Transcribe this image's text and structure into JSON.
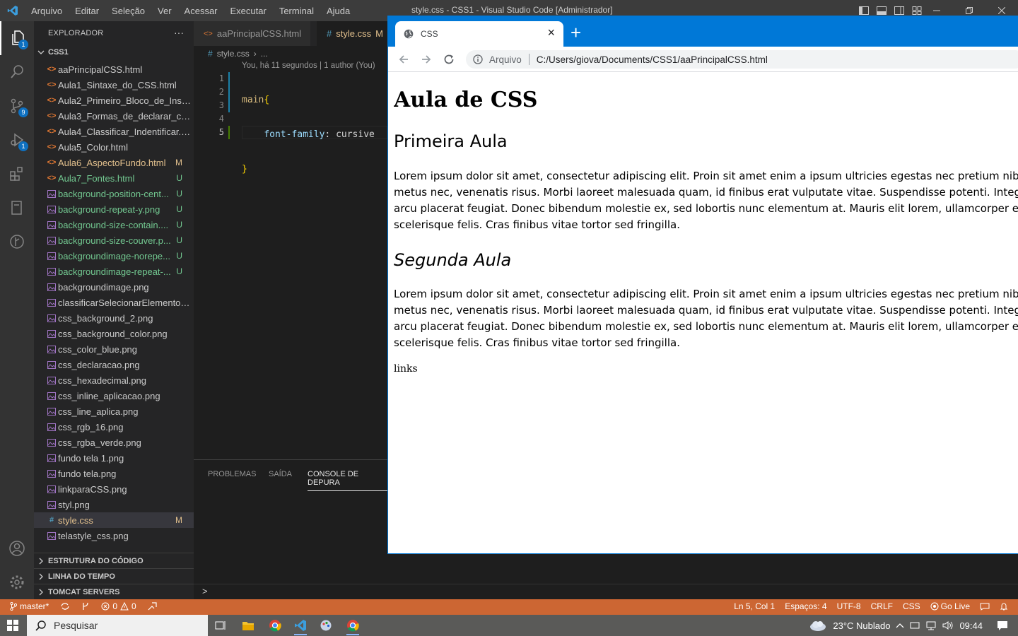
{
  "titlebar": {
    "menu": [
      "Arquivo",
      "Editar",
      "Seleção",
      "Ver",
      "Acessar",
      "Executar",
      "Terminal",
      "Ajuda"
    ],
    "title": "style.css - CSS1 - Visual Studio Code [Administrador]"
  },
  "activity": {
    "explorer_badge": "1",
    "scm_badge": "9",
    "debug_badge": "1"
  },
  "sidebar": {
    "title": "EXPLORADOR",
    "more": "···",
    "folder": "CSS1",
    "files": [
      {
        "icon": "<>",
        "name": "aaPrincipalCSS.html",
        "badge": "",
        "color": "#cccccc",
        "iconcolor": "#e37933"
      },
      {
        "icon": "<>",
        "name": "Aula1_Sintaxe_do_CSS.html",
        "badge": "",
        "color": "#cccccc",
        "iconcolor": "#e37933"
      },
      {
        "icon": "<>",
        "name": "Aula2_Primeiro_Bloco_de_Instru...",
        "badge": "",
        "color": "#cccccc",
        "iconcolor": "#e37933"
      },
      {
        "icon": "<>",
        "name": "Aula3_Formas_de_declarar_css....",
        "badge": "",
        "color": "#cccccc",
        "iconcolor": "#e37933"
      },
      {
        "icon": "<>",
        "name": "Aula4_Classificar_Indentificar.html",
        "badge": "",
        "color": "#cccccc",
        "iconcolor": "#e37933"
      },
      {
        "icon": "<>",
        "name": "Aula5_Color.html",
        "badge": "",
        "color": "#cccccc",
        "iconcolor": "#e37933"
      },
      {
        "icon": "<>",
        "name": "Aula6_AspectoFundo.html",
        "badge": "M",
        "color": "#e2c08d",
        "iconcolor": "#e37933"
      },
      {
        "icon": "<>",
        "name": "Aula7_Fontes.html",
        "badge": "U",
        "color": "#73c991",
        "iconcolor": "#e37933"
      },
      {
        "icon": "img",
        "name": "background-position-cent...",
        "badge": "U",
        "color": "#73c991",
        "iconcolor": "#a074c4"
      },
      {
        "icon": "img",
        "name": "background-repeat-y.png",
        "badge": "U",
        "color": "#73c991",
        "iconcolor": "#a074c4"
      },
      {
        "icon": "img",
        "name": "background-size-contain....",
        "badge": "U",
        "color": "#73c991",
        "iconcolor": "#a074c4"
      },
      {
        "icon": "img",
        "name": "background-size-couver.p...",
        "badge": "U",
        "color": "#73c991",
        "iconcolor": "#a074c4"
      },
      {
        "icon": "img",
        "name": "backgroundimage-norepe...",
        "badge": "U",
        "color": "#73c991",
        "iconcolor": "#a074c4"
      },
      {
        "icon": "img",
        "name": "backgroundimage-repeat-...",
        "badge": "U",
        "color": "#73c991",
        "iconcolor": "#a074c4"
      },
      {
        "icon": "img",
        "name": "backgroundimage.png",
        "badge": "",
        "color": "#cccccc",
        "iconcolor": "#a074c4"
      },
      {
        "icon": "img",
        "name": "classificarSelecionarElementos....",
        "badge": "",
        "color": "#cccccc",
        "iconcolor": "#a074c4"
      },
      {
        "icon": "img",
        "name": "css_background_2.png",
        "badge": "",
        "color": "#cccccc",
        "iconcolor": "#a074c4"
      },
      {
        "icon": "img",
        "name": "css_background_color.png",
        "badge": "",
        "color": "#cccccc",
        "iconcolor": "#a074c4"
      },
      {
        "icon": "img",
        "name": "css_color_blue.png",
        "badge": "",
        "color": "#cccccc",
        "iconcolor": "#a074c4"
      },
      {
        "icon": "img",
        "name": "css_declaracao.png",
        "badge": "",
        "color": "#cccccc",
        "iconcolor": "#a074c4"
      },
      {
        "icon": "img",
        "name": "css_hexadecimal.png",
        "badge": "",
        "color": "#cccccc",
        "iconcolor": "#a074c4"
      },
      {
        "icon": "img",
        "name": "css_inline_aplicacao.png",
        "badge": "",
        "color": "#cccccc",
        "iconcolor": "#a074c4"
      },
      {
        "icon": "img",
        "name": "css_line_aplica.png",
        "badge": "",
        "color": "#cccccc",
        "iconcolor": "#a074c4"
      },
      {
        "icon": "img",
        "name": "css_rgb_16.png",
        "badge": "",
        "color": "#cccccc",
        "iconcolor": "#a074c4"
      },
      {
        "icon": "img",
        "name": "css_rgba_verde.png",
        "badge": "",
        "color": "#cccccc",
        "iconcolor": "#a074c4"
      },
      {
        "icon": "img",
        "name": "fundo tela 1.png",
        "badge": "",
        "color": "#cccccc",
        "iconcolor": "#a074c4"
      },
      {
        "icon": "img",
        "name": "fundo tela.png",
        "badge": "",
        "color": "#cccccc",
        "iconcolor": "#a074c4"
      },
      {
        "icon": "img",
        "name": "linkparaCSS.png",
        "badge": "",
        "color": "#cccccc",
        "iconcolor": "#a074c4"
      },
      {
        "icon": "img",
        "name": "styl.png",
        "badge": "",
        "color": "#cccccc",
        "iconcolor": "#a074c4"
      },
      {
        "icon": "#",
        "name": "style.css",
        "badge": "M",
        "color": "#e2c08d",
        "iconcolor": "#519aba",
        "selected": true
      },
      {
        "icon": "img",
        "name": "telastyle_css.png",
        "badge": "",
        "color": "#cccccc",
        "iconcolor": "#a074c4"
      }
    ],
    "sections": [
      "ESTRUTURA DO CÓDIGO",
      "LINHA DO TEMPO",
      "TOMCAT SERVERS"
    ]
  },
  "editor": {
    "tabs": [
      {
        "icon": "<>",
        "label": "aaPrincipalCSS.html",
        "badge": ""
      },
      {
        "icon": "#",
        "label": "style.css",
        "badge": "M"
      }
    ],
    "breadcrumb": {
      "file": "style.css",
      "rest": "..."
    },
    "codelens": "You, há 11 segundos | 1 author (You)",
    "line_numbers": [
      "1",
      "2",
      "3",
      "4",
      "5"
    ],
    "code": {
      "l1_selector": "main",
      "l1_brace": "{",
      "l2_prop": "font-family",
      "l2_colon": ": ",
      "l2_value": "cursive",
      "l3_brace": "}"
    },
    "panel_tabs": [
      "PROBLEMAS",
      "SAÍDA",
      "CONSOLE DE DEPURA"
    ],
    "terminal_prompt": ">"
  },
  "browser": {
    "tab_title": "CSS",
    "tab_close": "×",
    "new_tab": "+",
    "site_info": "Arquivo",
    "url": "C:/Users/giova/Documents/CSS1/aaPrincipalCSS.html",
    "page": {
      "h1": "Aula de CSS",
      "h2a": "Primeira Aula",
      "p1": "Lorem ipsum dolor sit amet, consectetur adipiscing elit. Proin sit amet enim a ipsum ultricies egestas nec pretium nibh. Etiam iaculis metus nec, venenatis risus. Morbi laoreet malesuada quam, id finibus erat vulputate vitae. Suspendisse potenti. Integer sit amet arcu placerat feugiat. Donec bibendum molestie ex, sed lobortis nunc elementum at. Mauris elit lorem, ullamcorper et lacinia scelerisque felis. Cras finibus vitae tortor sed fringilla.",
      "h2b": "Segunda Aula",
      "p2": "Lorem ipsum dolor sit amet, consectetur adipiscing elit. Proin sit amet enim a ipsum ultricies egestas nec pretium nibh. Etiam iaculis metus nec, venenatis risus. Morbi laoreet malesuada quam, id finibus erat vulputate vitae. Suspendisse potenti. Integer sit amet arcu placerat feugiat. Donec bibendum molestie ex, sed lobortis nunc elementum at. Mauris elit lorem, ullamcorper et lacinia scelerisque felis. Cras finibus vitae tortor sed fringilla.",
      "links": "links"
    }
  },
  "statusbar": {
    "branch": "master*",
    "errors": "0",
    "warnings": "0",
    "position": "Ln 5, Col 1",
    "spaces": "Espaços: 4",
    "encoding": "UTF-8",
    "eol": "CRLF",
    "language": "CSS",
    "golive": "Go Live"
  },
  "taskbar": {
    "search_placeholder": "Pesquisar",
    "weather": "23°C  Nublado",
    "time": "09:44"
  },
  "colors": {
    "statusbar": "#cc6633",
    "browser_accent": "#0078d7"
  }
}
